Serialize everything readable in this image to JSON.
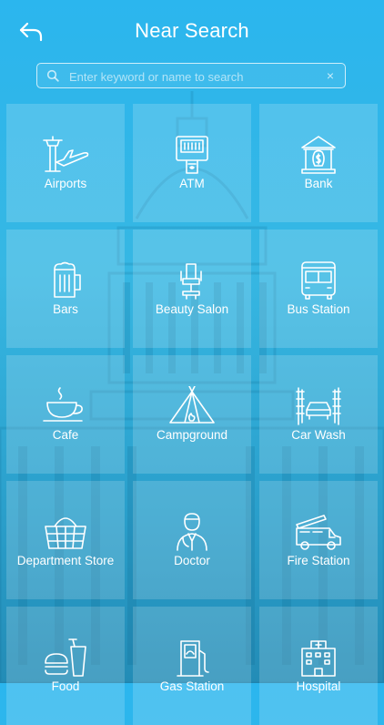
{
  "header": {
    "title": "Near Search",
    "back_icon": "back-arrow-icon"
  },
  "search": {
    "placeholder": "Enter keyword or name to search",
    "value": "",
    "clear_icon": "×"
  },
  "categories": [
    {
      "label": "Airports",
      "icon": "airport-icon"
    },
    {
      "label": "ATM",
      "icon": "atm-icon"
    },
    {
      "label": "Bank",
      "icon": "bank-icon"
    },
    {
      "label": "Bars",
      "icon": "beer-mug-icon"
    },
    {
      "label": "Beauty Salon",
      "icon": "salon-chair-icon"
    },
    {
      "label": "Bus Station",
      "icon": "bus-icon"
    },
    {
      "label": "Cafe",
      "icon": "coffee-cup-icon"
    },
    {
      "label": "Campground",
      "icon": "tent-icon"
    },
    {
      "label": "Car Wash",
      "icon": "car-wash-icon"
    },
    {
      "label": "Department Store",
      "icon": "shopping-basket-icon"
    },
    {
      "label": "Doctor",
      "icon": "doctor-icon"
    },
    {
      "label": "Fire Station",
      "icon": "fire-truck-icon"
    },
    {
      "label": "Food",
      "icon": "fast-food-icon"
    },
    {
      "label": "Gas Station",
      "icon": "gas-pump-icon"
    },
    {
      "label": "Hospital",
      "icon": "hospital-icon"
    }
  ]
}
